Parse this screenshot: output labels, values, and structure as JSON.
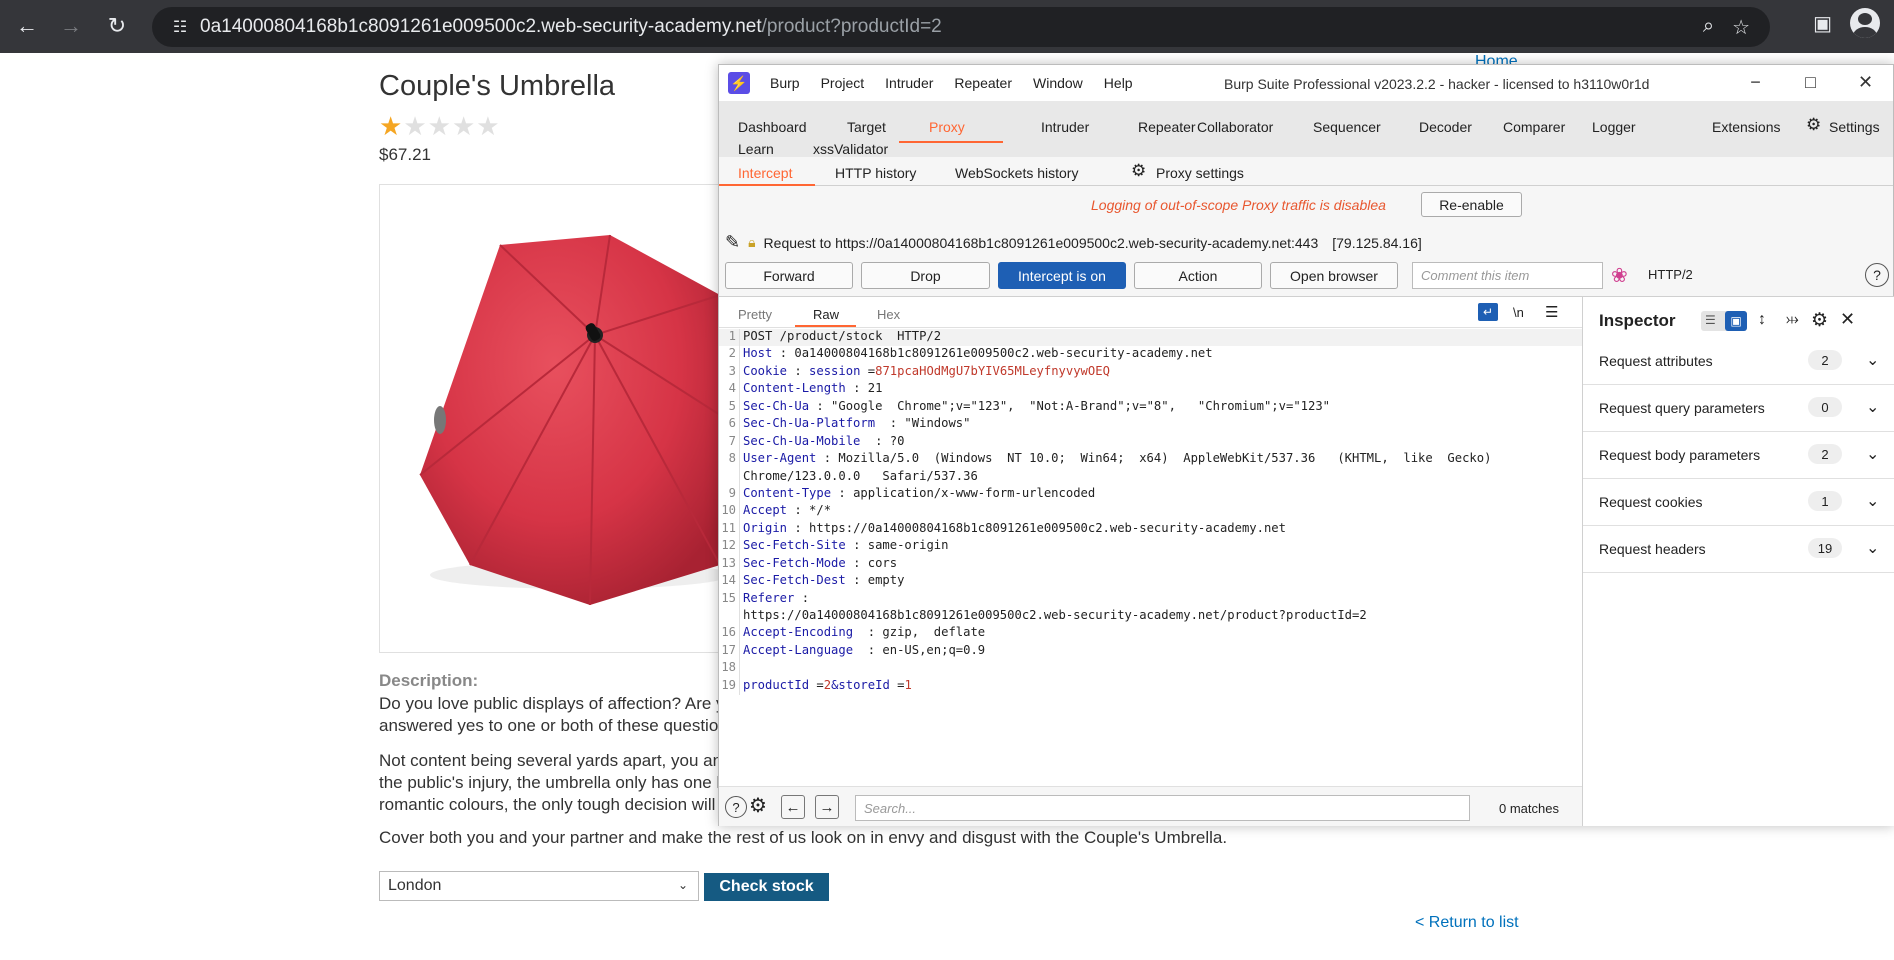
{
  "browser": {
    "url_host": "0a14000804168b1c8091261e009500c2.web-security-academy.net",
    "url_path": "/product?productId=2"
  },
  "page": {
    "home_link": "Home",
    "product_title": "Couple's Umbrella",
    "rating": {
      "value": 1,
      "max": 5
    },
    "price": "$67.21",
    "description_label": "Description:",
    "desc_line1": "Do you love public displays of affection? Are you",
    "desc_line2": "answered yes to one or both of these questions,",
    "desc_line3": "Not content being several yards apart, you and y",
    "desc_line4": "the public's injury, the umbrella only has one har",
    "desc_line5": "romantic colours, the only tough decision will be",
    "desc_line6": "Cover both you and your partner and make the rest of us look on in envy and disgust with the Couple's Umbrella.",
    "store_selected": "London",
    "check_stock_label": "Check stock",
    "return_link": "< Return to list"
  },
  "burp": {
    "menu": [
      "Burp",
      "Project",
      "Intruder",
      "Repeater",
      "Window",
      "Help"
    ],
    "window_title": "Burp Suite Professional v2023.2.2 - hacker - licensed to h3110w0r1d",
    "tabs_row1": [
      "Dashboard",
      "Target",
      "Proxy",
      "Intruder",
      "Repeater",
      "Collaborator",
      "Sequencer",
      "Decoder",
      "Comparer",
      "Logger",
      "Extensions",
      "Settings"
    ],
    "tabs_row1b": [
      "Learn",
      "xssValidator"
    ],
    "active_tab": "Proxy",
    "subtabs": [
      "Intercept",
      "HTTP history",
      "WebSockets history",
      "Proxy settings"
    ],
    "log_message": "Logging of out-of-scope Proxy traffic is disablea",
    "reenable": "Re-enable",
    "request_line": "Request to https://0a14000804168b1c8091261e009500c2.web-security-academy.net:443",
    "request_ip": "[79.125.84.16]",
    "buttons": {
      "forward": "Forward",
      "drop": "Drop",
      "intercept": "Intercept is on",
      "action": "Action",
      "open_browser": "Open browser"
    },
    "comment_placeholder": "Comment this item",
    "http_version": "HTTP/2",
    "view_tabs": [
      "Pretty",
      "Raw",
      "Hex"
    ],
    "newline_toggle": "\\n",
    "code": {
      "l1": "POST /product/stock  HTTP/2",
      "l2k": "Host",
      "l2v": " : 0a14000804168b1c8091261e009500c2.web-security-academy.net",
      "l3k": "Cookie",
      "l3s": " : ",
      "l3n": "session",
      "l3e": " =",
      "l3v": "871pcaHOdMgU7bYIV65MLeyfnyvywOEQ",
      "l4k": "Content-Length",
      "l4v": " : 21",
      "l5k": "Sec-Ch-Ua",
      "l5v": " : \"Google  Chrome\";v=\"123\",  \"Not:A-Brand\";v=\"8\",   \"Chromium\";v=\"123\"",
      "l6k": "Sec-Ch-Ua-Platform",
      "l6v": "  : \"Windows\"",
      "l7k": "Sec-Ch-Ua-Mobile",
      "l7v": "  : ?0",
      "l8k": "User-Agent",
      "l8v": " : Mozilla/5.0  (Windows  NT 10.0;  Win64;  x64)  AppleWebKit/537.36   (KHTML,  like  Gecko)",
      "l8b": "Chrome/123.0.0.0   Safari/537.36",
      "l9k": "Content-Type",
      "l9v": " : application/x-www-form-urlencoded",
      "l10k": "Accept",
      "l10v": " : */*",
      "l11k": "Origin",
      "l11v": " : https://0a14000804168b1c8091261e009500c2.web-security-academy.net",
      "l12k": "Sec-Fetch-Site",
      "l12v": " : same-origin",
      "l13k": "Sec-Fetch-Mode",
      "l13v": " : cors",
      "l14k": "Sec-Fetch-Dest",
      "l14v": " : empty",
      "l15k": "Referer",
      "l15v": " :",
      "l15b": "https://0a14000804168b1c8091261e009500c2.web-security-academy.net/product?productId=2",
      "l16k": "Accept-Encoding",
      "l16v": "  : gzip,  deflate",
      "l17k": "Accept-Language",
      "l17v": "  : en-US,en;q=0.9",
      "l19a": "productId",
      "l19b": " =",
      "l19c": "2",
      "l19d": "&storeId",
      "l19e": " =",
      "l19f": "1"
    },
    "search_placeholder": "Search...",
    "matches": "0 matches",
    "inspector": {
      "title": "Inspector",
      "rows": [
        {
          "label": "Request attributes",
          "count": "2"
        },
        {
          "label": "Request query parameters",
          "count": "0"
        },
        {
          "label": "Request body parameters",
          "count": "2"
        },
        {
          "label": "Request cookies",
          "count": "1"
        },
        {
          "label": "Request headers",
          "count": "19"
        }
      ]
    }
  }
}
